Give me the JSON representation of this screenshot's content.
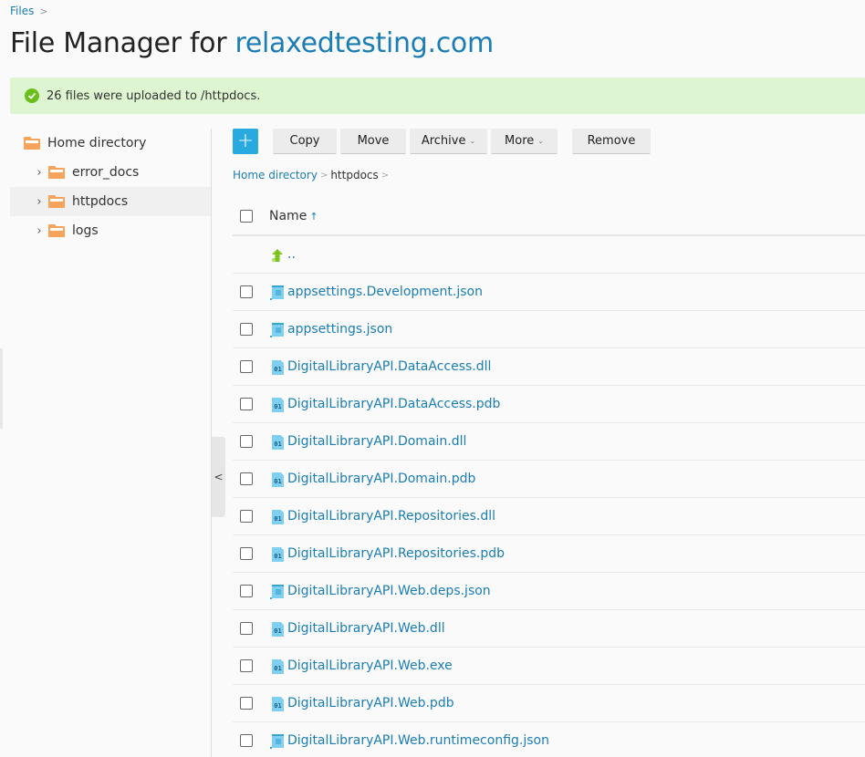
{
  "breadcrumb_top": {
    "label": "Files",
    "separator": ">"
  },
  "header": {
    "title_prefix": "File Manager for ",
    "domain": "relaxedtesting.com"
  },
  "message": {
    "icon": "check-circle-icon",
    "text": "26 files were uploaded to /httpdocs."
  },
  "sidebar": {
    "root": {
      "label": "Home directory",
      "icon": "folder-icon"
    },
    "items": [
      {
        "label": "error_docs",
        "icon": "folder-icon",
        "selected": false
      },
      {
        "label": "httpdocs",
        "icon": "folder-icon",
        "selected": true
      },
      {
        "label": "logs",
        "icon": "folder-icon",
        "selected": false
      }
    ],
    "collapse_label": "<"
  },
  "toolbar": {
    "add_label": "+",
    "copy_label": "Copy",
    "move_label": "Move",
    "archive_label": "Archive",
    "more_label": "More",
    "remove_label": "Remove",
    "caret": "⌄"
  },
  "path": {
    "items": [
      "Home directory",
      "httpdocs"
    ],
    "separator": ">"
  },
  "list": {
    "name_header": "Name",
    "sort_indicator": "↑",
    "parent_label": "..",
    "files": [
      {
        "name": "appsettings.Development.json",
        "type": "json"
      },
      {
        "name": "appsettings.json",
        "type": "json"
      },
      {
        "name": "DigitalLibraryAPI.DataAccess.dll",
        "type": "bin"
      },
      {
        "name": "DigitalLibraryAPI.DataAccess.pdb",
        "type": "bin"
      },
      {
        "name": "DigitalLibraryAPI.Domain.dll",
        "type": "bin"
      },
      {
        "name": "DigitalLibraryAPI.Domain.pdb",
        "type": "bin"
      },
      {
        "name": "DigitalLibraryAPI.Repositories.dll",
        "type": "bin"
      },
      {
        "name": "DigitalLibraryAPI.Repositories.pdb",
        "type": "bin"
      },
      {
        "name": "DigitalLibraryAPI.Web.deps.json",
        "type": "json"
      },
      {
        "name": "DigitalLibraryAPI.Web.dll",
        "type": "bin"
      },
      {
        "name": "DigitalLibraryAPI.Web.exe",
        "type": "bin"
      },
      {
        "name": "DigitalLibraryAPI.Web.pdb",
        "type": "bin"
      },
      {
        "name": "DigitalLibraryAPI.Web.runtimeconfig.json",
        "type": "json"
      }
    ],
    "bin_icon_text": "01"
  },
  "colors": {
    "accent": "#1a7db5",
    "add_button": "#28a9e0",
    "success_bg": "#ddf5d0",
    "success_icon": "#6cbe1c",
    "folder": "#f7a35c"
  }
}
